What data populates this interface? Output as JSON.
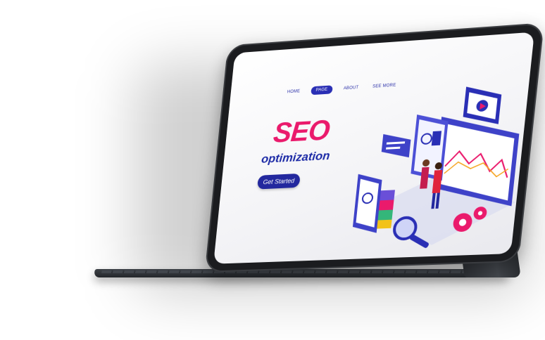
{
  "nav": {
    "items": [
      "HOME",
      "PAGE",
      "ABOUT",
      "SEE MORE"
    ],
    "active_index": 1
  },
  "hero": {
    "title": "SEO",
    "subtitle": "optimization",
    "cta_label": "Get Started"
  },
  "colors": {
    "accent": "#ea1a6c",
    "brand": "#1c2aa6",
    "button": "#23289e"
  },
  "icons": [
    "play-icon",
    "magnifier-icon",
    "gear-icon",
    "chart-icon",
    "refresh-icon"
  ]
}
